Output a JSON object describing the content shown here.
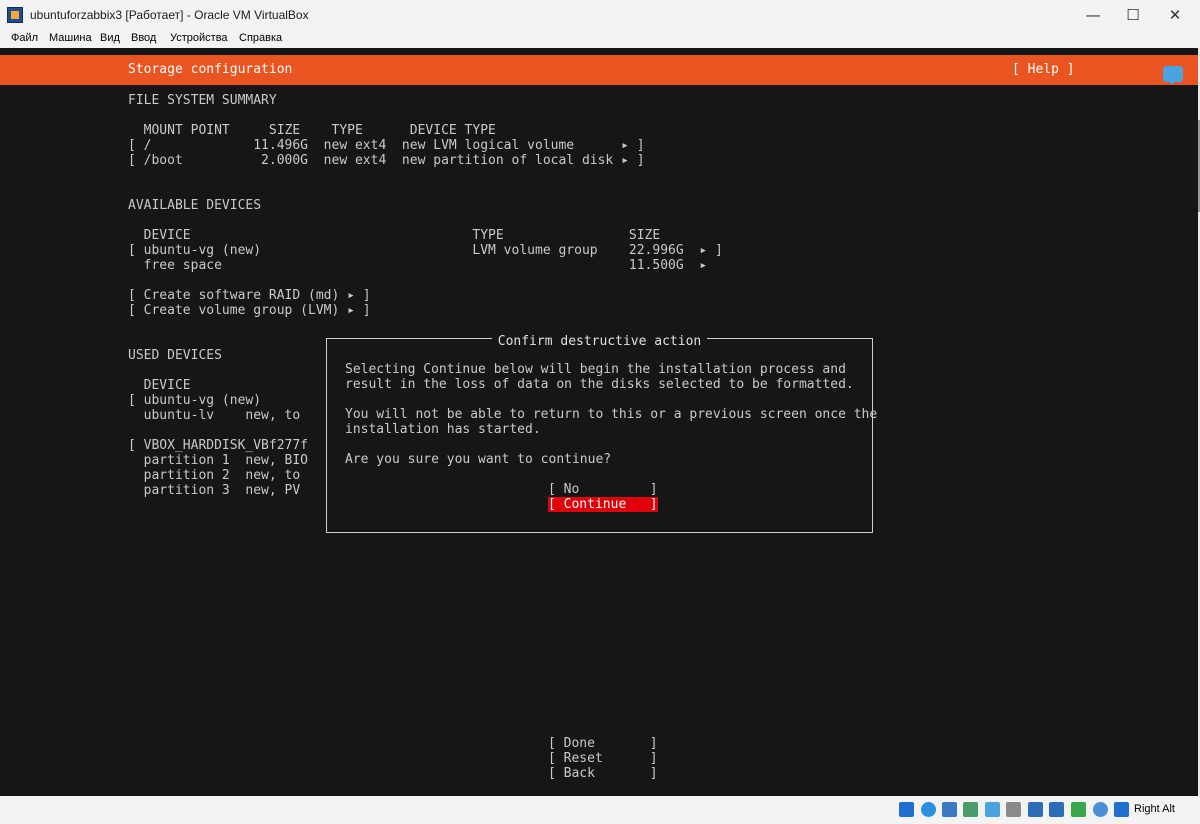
{
  "window": {
    "title": "ubuntuforzabbix3 [Работает] - Oracle VM VirtualBox",
    "minimize_glyph": "—",
    "maximize_glyph": "☐",
    "close_glyph": "✕"
  },
  "menu": {
    "items": [
      "Файл",
      "Машина",
      "Вид",
      "Ввод",
      "Устройства",
      "Справка"
    ]
  },
  "installer": {
    "title": "Storage configuration",
    "help": "[ Help ]",
    "fs_summary": {
      "heading": "FILE SYSTEM SUMMARY",
      "header_row": "  MOUNT POINT     SIZE    TYPE      DEVICE TYPE",
      "rows": [
        "[ /             11.496G  new ext4  new LVM logical volume      ▸ ]",
        "[ /boot          2.000G  new ext4  new partition of local disk ▸ ]"
      ]
    },
    "available": {
      "heading": "AVAILABLE DEVICES",
      "header_row": "  DEVICE                                    TYPE                SIZE",
      "rows": [
        "[ ubuntu-vg (new)                           LVM volume group    22.996G  ▸ ]",
        "  free space                                                    11.500G  ▸"
      ],
      "actions": [
        "[ Create software RAID (md) ▸ ]",
        "[ Create volume group (LVM) ▸ ]"
      ]
    },
    "used": {
      "heading": "USED DEVICES",
      "header_row": "  DEVICE",
      "rows": [
        "[ ubuntu-vg (new)",
        "  ubuntu-lv    new, to",
        "",
        "[ VBOX_HARDDISK_VBf277f",
        "  partition 1  new, BIO",
        "  partition 2  new, to",
        "  partition 3  new, PV"
      ]
    },
    "bottom_buttons": [
      "[ Done       ]",
      "[ Reset      ]",
      "[ Back       ]"
    ]
  },
  "dialog": {
    "title": "Confirm destructive action",
    "line1": "Selecting Continue below will begin the installation process and",
    "line2": "result in the loss of data on the disks selected to be formatted.",
    "line3": "You will not be able to return to this or a previous screen once the",
    "line4": "installation has started.",
    "line5": "Are you sure you want to continue?",
    "no_button": "[ No         ]",
    "continue_button": "[ Continue   ]"
  },
  "statusbar": {
    "host_key": "Right Alt"
  },
  "colors": {
    "accent": "#e95420",
    "selected": "#e0000a",
    "terminal_bg": "#161616"
  }
}
